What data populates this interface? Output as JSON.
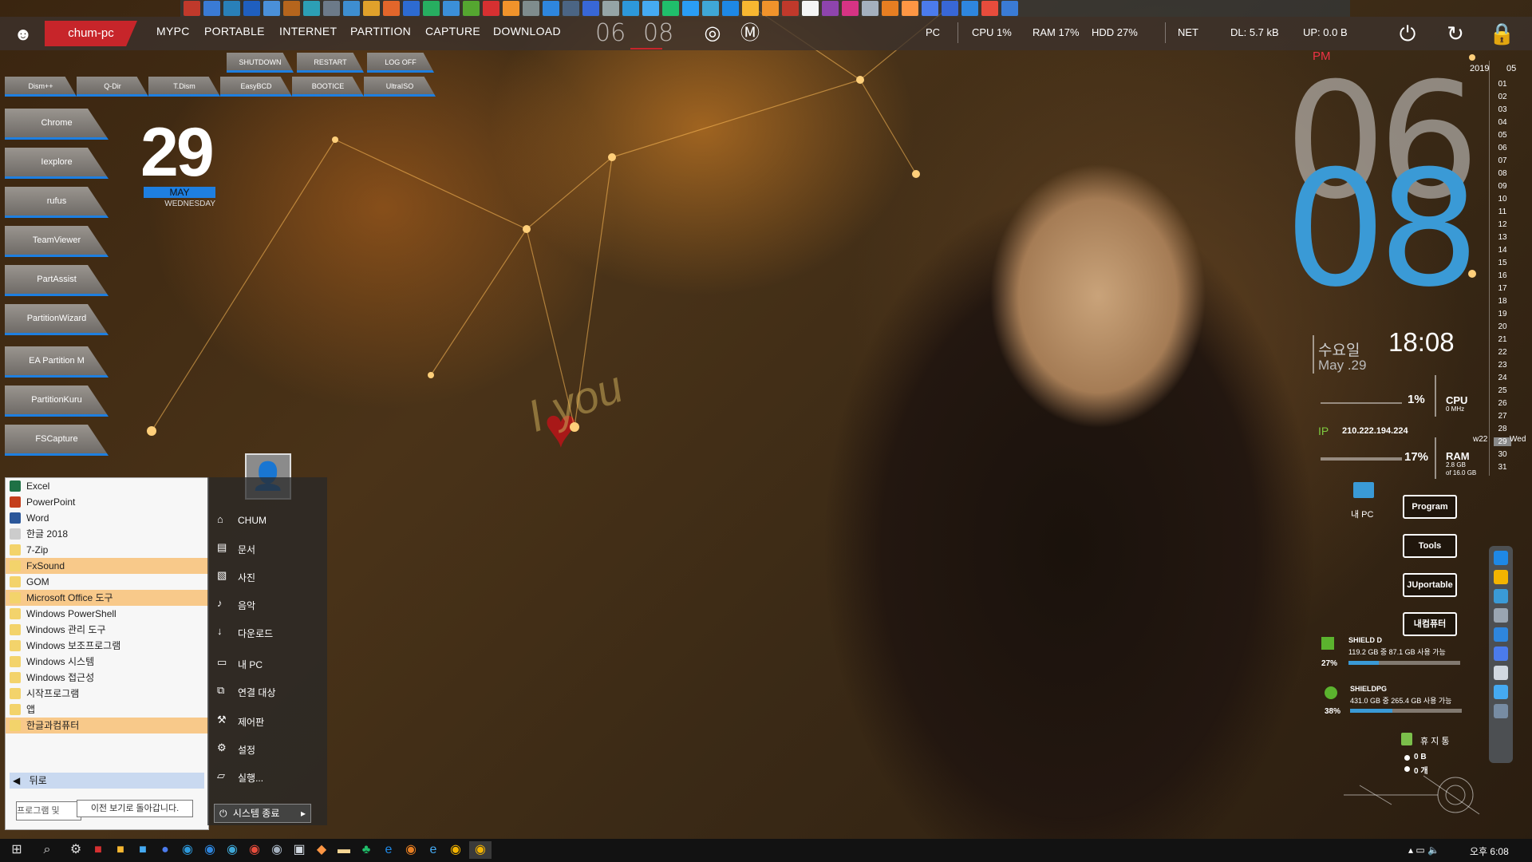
{
  "top": {
    "pc_name": "chum-pc",
    "menu": [
      "MYPC",
      "PORTABLE",
      "INTERNET",
      "PARTITION",
      "CAPTURE",
      "DOWNLOAD"
    ],
    "time_hour": "06",
    "time_min": "08",
    "pc_label": "PC",
    "cpu": "CPU  1%",
    "ram": "RAM  17%",
    "hdd": "HDD  27%",
    "net_label": "NET",
    "dl": "DL:  5.7 kB",
    "up": "UP:  0.0 B"
  },
  "quick": {
    "power_row": [
      "SHUTDOWN",
      "RESTART",
      "LOG OFF"
    ],
    "tools_row": [
      "Dism++",
      "Q-Dir",
      "T.Dism",
      "EasyBCD",
      "BOOTICE",
      "UltraISO"
    ],
    "left_buttons": [
      "Chrome",
      "Iexplore",
      "rufus",
      "TeamViewer",
      "PartAssist",
      "PartitionWizard",
      "EA Partition M",
      "PartitionKuru",
      "FSCapture"
    ]
  },
  "date_widget": {
    "day": "29",
    "month": "MAY",
    "weekday": "WEDNESDAY"
  },
  "big_clock": {
    "ampm": "PM",
    "hour": "06",
    "minute": "08"
  },
  "clock_small": {
    "weekday_ko": "수요일",
    "date": "May .29",
    "time": "18:08"
  },
  "sys": {
    "cpu_pct": "1%",
    "cpu_label": "CPU",
    "cpu_mhz": "0 MHz",
    "ip_label": "IP",
    "ip": "210.222.194.224",
    "ram_pct": "17%",
    "ram_label": "RAM",
    "ram_used": "2.8 GB",
    "ram_total": "of 16.0 GB"
  },
  "calendar": {
    "year": "2019",
    "month": "05",
    "days": [
      "01",
      "02",
      "03",
      "04",
      "05",
      "06",
      "07",
      "08",
      "09",
      "10",
      "11",
      "12",
      "13",
      "14",
      "15",
      "16",
      "17",
      "18",
      "19",
      "20",
      "21",
      "22",
      "23",
      "24",
      "25",
      "26",
      "27",
      "28",
      "29",
      "30",
      "31"
    ],
    "week_label": "w22",
    "today_label": "Wed"
  },
  "right_buttons": [
    "Program",
    "Tools",
    "JUportable",
    "내컴퓨터"
  ],
  "mypc_label": "내 PC",
  "drives": [
    {
      "name": "SHIELD D",
      "info": "119.2 GB 중 87.1 GB 사용 가능",
      "pct": "27%",
      "fill": 0.27
    },
    {
      "name": "SHIELDPG",
      "info": "431.0 GB 중 265.4 GB 사용 가능",
      "pct": "38%",
      "fill": 0.38
    }
  ],
  "recycle": {
    "label": "휴 지 통",
    "size": "0 B",
    "count": "0 개"
  },
  "start_menu": {
    "items": [
      {
        "label": "Excel",
        "color": "#1e7145",
        "hl": false
      },
      {
        "label": "PowerPoint",
        "color": "#c43e1c",
        "hl": false
      },
      {
        "label": "Word",
        "color": "#2b579a",
        "hl": false
      },
      {
        "label": "한글 2018",
        "color": "#cccccc",
        "hl": false
      },
      {
        "label": "7-Zip",
        "color": "#f3d36b",
        "hl": false
      },
      {
        "label": "FxSound",
        "color": "#f3d36b",
        "hl": true
      },
      {
        "label": "GOM",
        "color": "#f3d36b",
        "hl": false
      },
      {
        "label": "Microsoft Office 도구",
        "color": "#f3d36b",
        "hl": true
      },
      {
        "label": "Windows PowerShell",
        "color": "#f3d36b",
        "hl": false
      },
      {
        "label": "Windows 관리 도구",
        "color": "#f3d36b",
        "hl": false
      },
      {
        "label": "Windows 보조프로그램",
        "color": "#f3d36b",
        "hl": false
      },
      {
        "label": "Windows 시스템",
        "color": "#f3d36b",
        "hl": false
      },
      {
        "label": "Windows 접근성",
        "color": "#f3d36b",
        "hl": false
      },
      {
        "label": "시작프로그램",
        "color": "#f3d36b",
        "hl": false
      },
      {
        "label": "앱",
        "color": "#f3d36b",
        "hl": false
      },
      {
        "label": "한글과컴퓨터",
        "color": "#f3d36b",
        "hl": true
      }
    ],
    "back": "뒤로",
    "search_placeholder": "프로그램 및",
    "tooltip": "이전 보기로 돌아갑니다.",
    "right": [
      "CHUM",
      "문서",
      "사진",
      "음악",
      "다운로드",
      "내 PC",
      "연결 대상",
      "제어판",
      "설정",
      "실행..."
    ],
    "shutdown": "시스템 종료"
  },
  "taskbar": {
    "time": "오후 6:08"
  },
  "wallpaper_text": "I you"
}
